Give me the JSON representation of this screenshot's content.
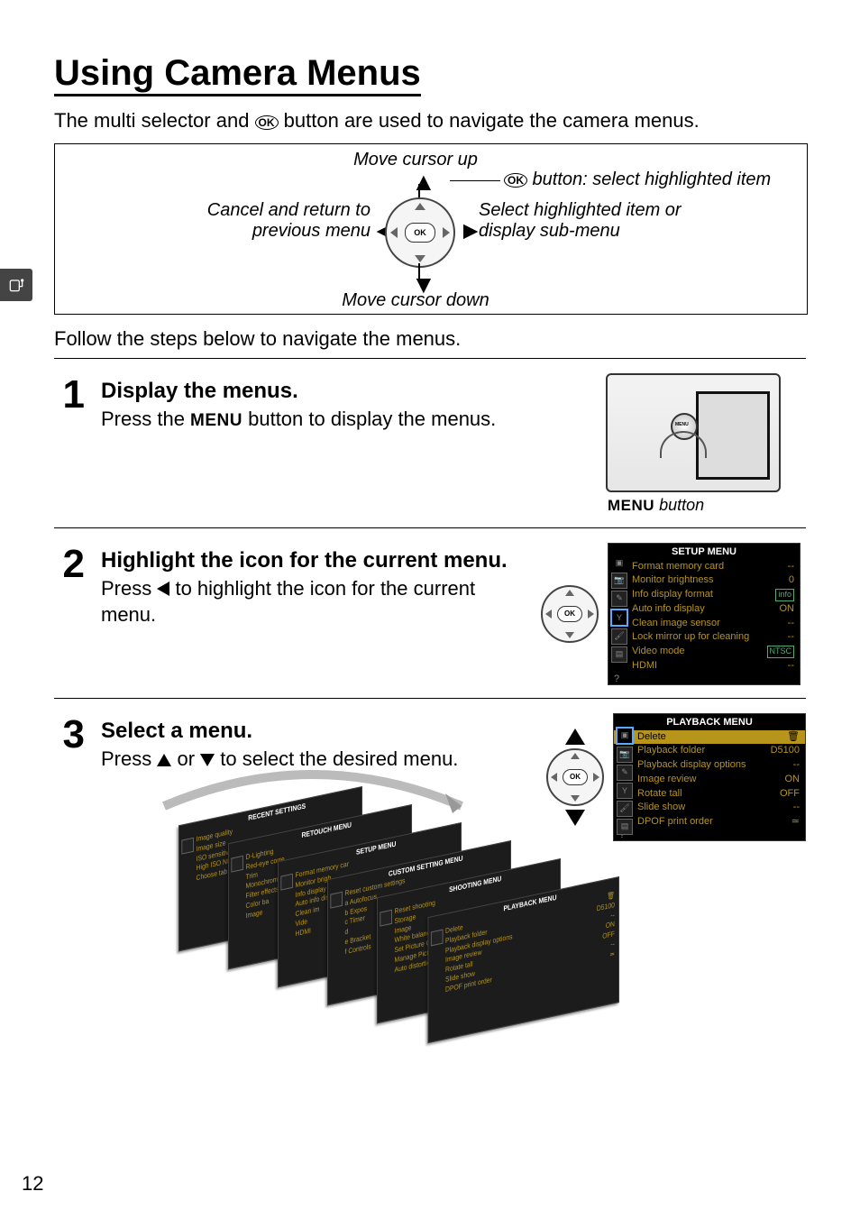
{
  "page_number": "12",
  "title": "Using Camera Menus",
  "intro_pre": "The multi selector and ",
  "intro_ok": "OK",
  "intro_post": " button are used to navigate the camera menus.",
  "diagram": {
    "move_up": "Move cursor up",
    "move_down": "Move cursor down",
    "cancel_l1": "Cancel and return to",
    "cancel_l2": "previous menu",
    "select_l1": "Select highlighted item or",
    "select_l2": "display sub-menu",
    "ok_button": " button: select highlighted item",
    "ok_label": "OK"
  },
  "follow": "Follow the steps below to navigate the menus.",
  "steps": [
    {
      "num": "1",
      "title": "Display the menus.",
      "text_pre": "Press the ",
      "menu_word": "MENU",
      "text_post": " button to display the menus.",
      "caption_word": "MENU",
      "caption_rest": " button"
    },
    {
      "num": "2",
      "title": "Highlight the icon for the current menu.",
      "text": "Press ◀ to highlight the icon for the current menu."
    },
    {
      "num": "3",
      "title": "Select a menu.",
      "text": "Press ▲ or ▼ to select the desired menu."
    }
  ],
  "setup_menu": {
    "header": "SETUP MENU",
    "items": [
      {
        "label": "Format memory card",
        "val": "--"
      },
      {
        "label": "Monitor brightness",
        "val": "0"
      },
      {
        "label": "Info display format",
        "val": "info"
      },
      {
        "label": "Auto info display",
        "val": "ON"
      },
      {
        "label": "Clean image sensor",
        "val": "--"
      },
      {
        "label": "Lock mirror up for cleaning",
        "val": "--"
      },
      {
        "label": "Video mode",
        "val": "NTSC"
      },
      {
        "label": "HDMI",
        "val": "--"
      }
    ]
  },
  "playback_menu": {
    "header": "PLAYBACK MENU",
    "items": [
      {
        "label": "Delete",
        "val": "🗑"
      },
      {
        "label": "Playback folder",
        "val": "D5100"
      },
      {
        "label": "Playback display options",
        "val": "--"
      },
      {
        "label": "Image review",
        "val": "ON"
      },
      {
        "label": "Rotate tall",
        "val": "OFF"
      },
      {
        "label": "Slide show",
        "val": "--"
      },
      {
        "label": "DPOF print order",
        "val": "≃"
      }
    ]
  },
  "stack": {
    "cards": [
      {
        "title": "RECENT SETTINGS",
        "lines": [
          "Image quality",
          "Image size",
          "ISO sensitivity",
          "High ISO NR",
          "Choose tab"
        ]
      },
      {
        "title": "RETOUCH MENU",
        "lines": [
          "D-Lighting",
          "Red-eye corre",
          "Trim",
          "Monochrome",
          "Filter effects",
          "Color ba",
          "Image"
        ]
      },
      {
        "title": "SETUP MENU",
        "lines": [
          "Format memory car",
          "Monitor brigh",
          "Info display fo",
          "Auto info disp",
          "Clean im",
          "Vide",
          "HDMI"
        ]
      },
      {
        "title": "CUSTOM SETTING MENU",
        "lines": [
          "Reset custom settings",
          "a Autofocus",
          "b Expos",
          "c Timer",
          "d",
          "e Bracket",
          "f Controls"
        ]
      },
      {
        "title": "SHOOTING MENU",
        "lines": [
          "Reset shooting",
          "Storage",
          "Image",
          "White balance",
          "Set Picture Co",
          "Manage Pictu",
          "Auto distortio"
        ]
      },
      {
        "title": "PLAYBACK MENU",
        "lines": [
          "Delete",
          "Playback folder",
          "Playback display options",
          "Image review",
          "Rotate tall",
          "Slide show",
          "DPOF print order"
        ]
      }
    ]
  }
}
